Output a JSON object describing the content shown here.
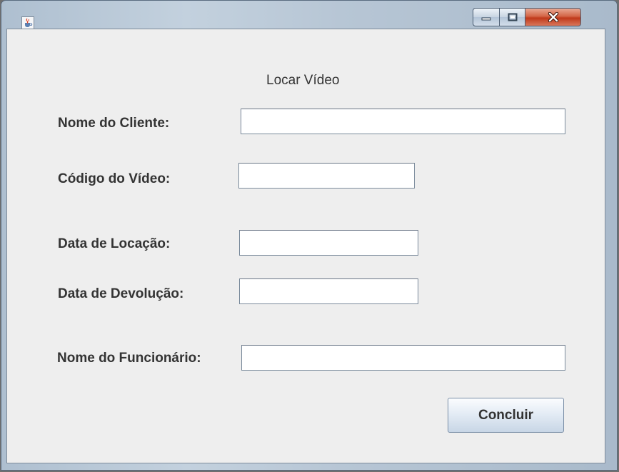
{
  "window": {
    "title": "",
    "icon": "java-cup-icon",
    "controls": {
      "minimize": "minimize-icon",
      "maximize": "maximize-icon",
      "close": "close-icon"
    }
  },
  "form": {
    "heading": "Locar Vídeo",
    "fields": {
      "client_name": {
        "label": "Nome do Cliente:",
        "value": ""
      },
      "video_code": {
        "label": "Código do Vídeo:",
        "value": ""
      },
      "rental_date": {
        "label": "Data de Locação:",
        "value": ""
      },
      "return_date": {
        "label": "Data de Devolução:",
        "value": ""
      },
      "employee_name": {
        "label": "Nome do Funcionário:",
        "value": ""
      }
    },
    "submit_label": "Concluir"
  },
  "colors": {
    "window_background": "#eeeeee",
    "title_bar": "#b7c6d5",
    "close_button": "#c0391b",
    "text": "#333333"
  }
}
